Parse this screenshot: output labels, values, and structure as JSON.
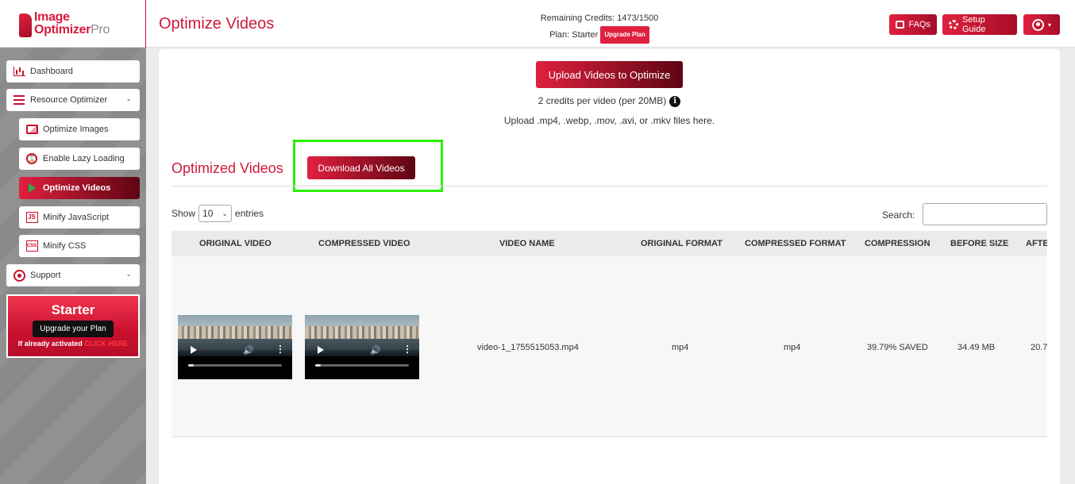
{
  "brand": {
    "line1": "Image",
    "line2": "Optimizer",
    "suffix": "Pro"
  },
  "header": {
    "title": "Optimize Videos",
    "credits_label": "Remaining Credits: 1473/1500",
    "plan_label": "Plan: Starter",
    "upgrade_badge": "Upgrade Plan",
    "faq_label": "FAQs",
    "guide_label": "Setup Guide",
    "user_caret": "▾"
  },
  "sidebar": {
    "items": [
      {
        "label": "Dashboard",
        "icon": "bar-chart-icon"
      },
      {
        "label": "Resource Optimizer",
        "icon": "list-icon"
      },
      {
        "label": "Optimize Images",
        "icon": "image-icon"
      },
      {
        "label": "Enable Lazy Loading",
        "icon": "lazy-load-icon"
      },
      {
        "label": "Optimize Videos",
        "icon": "play-icon"
      },
      {
        "label": "Minify JavaScript",
        "icon": "js-file-icon"
      },
      {
        "label": "Minify CSS",
        "icon": "css-file-icon"
      },
      {
        "label": "Support",
        "icon": "support-icon"
      }
    ],
    "promo": {
      "title": "Starter",
      "button": "Upgrade your Plan",
      "note": "If already activated",
      "link": "CLICK HERE"
    }
  },
  "upload": {
    "button": "Upload Videos to Optimize",
    "credits_note": "2 credits per video (per 20MB)",
    "formats_note": "Upload .mp4, .webp, .mov, .avi, or .mkv files here."
  },
  "optimized": {
    "title": "Optimized Videos",
    "download_all": "Download All Videos"
  },
  "table_controls": {
    "show": "Show",
    "page_size": "10",
    "entries": "entries",
    "search_label": "Search:",
    "search_value": ""
  },
  "table": {
    "columns": [
      "ORIGINAL VIDEO",
      "COMPRESSED VIDEO",
      "VIDEO NAME",
      "ORIGINAL FORMAT",
      "COMPRESSED FORMAT",
      "COMPRESSION",
      "BEFORE SIZE",
      "AFTE"
    ],
    "rows": [
      {
        "video_name": "video-1_1755515053.mp4",
        "original_format": "mp4",
        "compressed_format": "mp4",
        "compression": "39.79% SAVED",
        "before_size": "34.49 MB",
        "after_size": "20.7"
      }
    ]
  },
  "colors": {
    "accent": "#d0193b",
    "highlight": "#2cf000"
  }
}
